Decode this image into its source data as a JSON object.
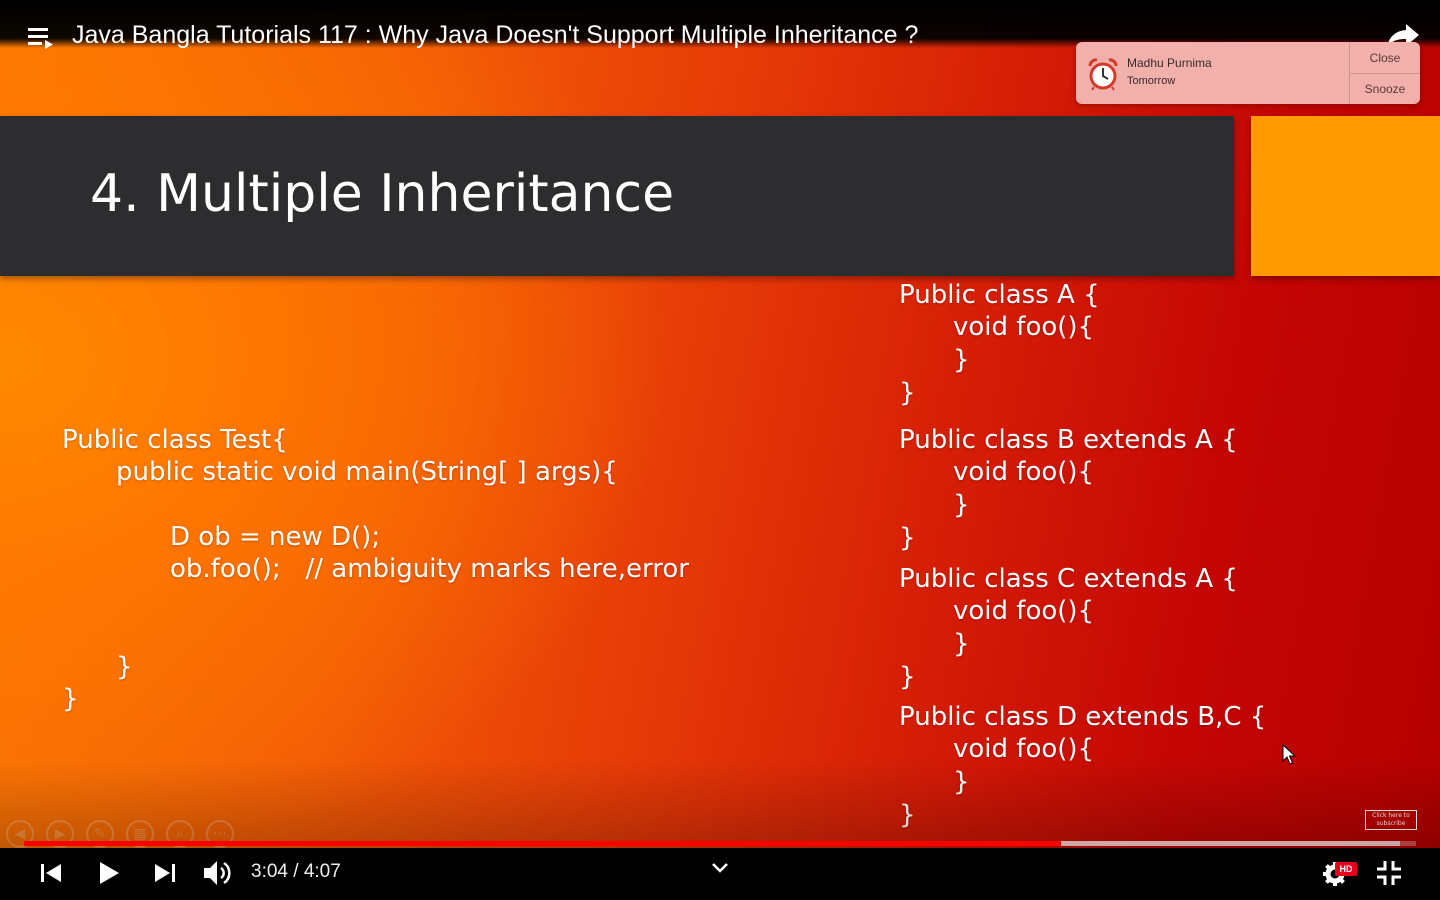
{
  "player": {
    "video_title": "Java Bangla Tutorials 117 : Why Java Doesn't Support Multiple Inheritance ?",
    "current_time": "3:04",
    "duration": "4:07",
    "time_display": "3:04 / 4:07",
    "progress_fraction": 0.745,
    "buffered_fraction": 0.9885,
    "hd_badge": "HD",
    "accent_color": "#ff0000"
  },
  "notification": {
    "name": "Madhu Purnima",
    "subtitle": "Tomorrow",
    "close_label": "Close",
    "snooze_label": "Snooze",
    "icon": "alarm-clock-icon"
  },
  "slide": {
    "title": "4. Multiple Inheritance",
    "left_code": {
      "line1": "Public class Test{",
      "line2": "public static void main(String[ ] args){",
      "line3": "D ob = new D();",
      "line4": "ob.foo();   // ambiguity marks here,error",
      "line5": "}",
      "line6": "}"
    },
    "class_a": {
      "header": "Public class A {",
      "method": "void foo(){",
      "inner_close": "}",
      "close": "}"
    },
    "class_b": {
      "header": "Public class B extends A {",
      "method": "void foo(){",
      "inner_close": "}",
      "close": "}"
    },
    "class_c": {
      "header": "Public class C extends A {",
      "method": "void foo(){",
      "inner_close": "}",
      "close": "}"
    },
    "class_d": {
      "header": "Public class D extends B,C {",
      "method": "void foo(){",
      "inner_close": "}",
      "close": "}"
    },
    "subscribe_badge": "Click here to subscribe"
  }
}
